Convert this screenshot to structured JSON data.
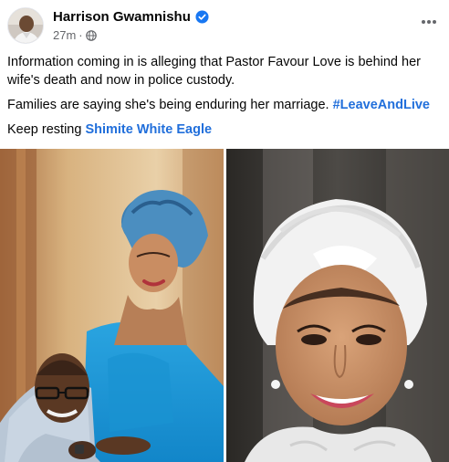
{
  "post": {
    "author": "Harrison Gwamnishu",
    "timestamp": "27m",
    "separator": "·",
    "paragraph1": "Information coming in is alleging that Pastor Favour Love is behind her wife's death and now in police custody.",
    "paragraph2_text": "Families are saying she's being enduring her marriage.",
    "hashtag": "#LeaveAndLive",
    "paragraph3_text": "Keep resting",
    "mention": "Shimite White Eagle"
  },
  "icons": {
    "verified": "verified-badge-icon",
    "privacy": "globe-icon",
    "more": "more-options-icon"
  },
  "colors": {
    "link": "#216fdb",
    "verified": "#1877f2",
    "secondary_text": "#65676b"
  }
}
